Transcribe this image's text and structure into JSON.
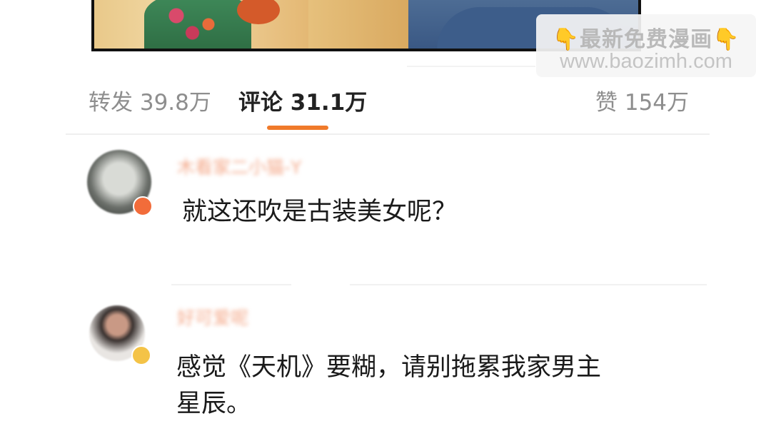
{
  "watermark": {
    "line1": "最新免费漫画",
    "hand_left": "👇",
    "hand_right": "👇",
    "line2": "www.baozimh.com"
  },
  "tabs": [
    {
      "label": "转发 39.8万",
      "active": false
    },
    {
      "label": "评论 31.1万",
      "active": true
    },
    {
      "label": "赞 154万",
      "active": false
    }
  ],
  "comments": [
    {
      "username": "木看家二小猫-Y",
      "text": "就这还吹是古装美女呢？",
      "badge_color": "#f26c3a"
    },
    {
      "username": "好可爱呢",
      "text_line1": "感觉《天机》要糊，请别拖累我家男主",
      "text_line2": "星辰。",
      "badge_color": "#f4c347"
    }
  ],
  "colors": {
    "accent": "#f07a2a",
    "tab_inactive": "#8e8e8e",
    "tab_active": "#222222"
  }
}
